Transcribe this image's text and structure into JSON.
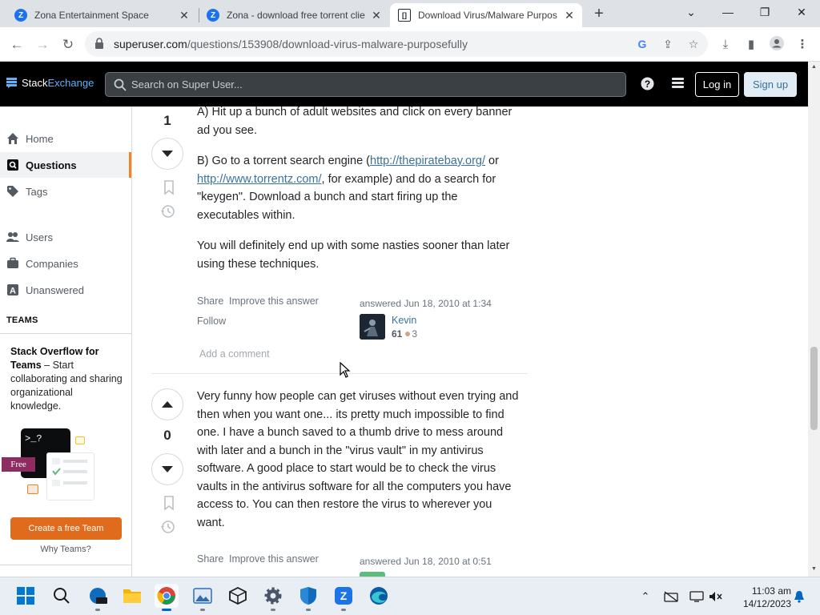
{
  "browser": {
    "tabs": [
      {
        "title": "Zona Entertainment Space",
        "favicon": "Z"
      },
      {
        "title": "Zona - download free torrent clie",
        "favicon": "Z"
      },
      {
        "title": "Download Virus/Malware Purpos",
        "favicon": "[]"
      }
    ],
    "url_host": "superuser.com",
    "url_path": "/questions/153908/download-virus-malware-purposefully"
  },
  "site": {
    "logo_part1": "Stack",
    "logo_part2": "Exchange",
    "search_placeholder": "Search on Super User...",
    "login_label": "Log in",
    "signup_label": "Sign up"
  },
  "sidebar": {
    "items": [
      {
        "label": "Home",
        "icon": "home-icon"
      },
      {
        "label": "Questions",
        "icon": "questions-icon"
      },
      {
        "label": "Tags",
        "icon": "tag-icon"
      },
      {
        "label": "Users",
        "icon": "users-icon"
      },
      {
        "label": "Companies",
        "icon": "companies-icon"
      },
      {
        "label": "Unanswered",
        "icon": "unanswered-icon"
      }
    ],
    "teams_heading": "TEAMS",
    "teams_title": "Stack Overflow for Teams",
    "teams_desc": " – Start collaborating and sharing organizational knowledge.",
    "free_badge": "Free",
    "terminal_text": ">_?",
    "create_team_label": "Create a free Team",
    "why_teams_label": "Why Teams?"
  },
  "answers": [
    {
      "score": "1",
      "p1": "A) Hit up a bunch of adult websites and click on every banner ad you see.",
      "p2_before": "B) Go to a torrent search engine (",
      "link1": "http://thepiratebay.org/",
      "p2_mid": " or ",
      "link2": "http://www.torrentz.com/",
      "p2_after": ", for example) and do a search for \"keygen\". Download a bunch and start firing up the executables within.",
      "p3": "You will definitely end up with some nasties sooner than later using these techniques.",
      "share": "Share",
      "improve": "Improve this answer",
      "follow": "Follow",
      "answered": "answered Jun 18, 2010 at 1:34",
      "user_name": "Kevin",
      "user_rep": "61",
      "user_bronze": "3",
      "add_comment": "Add a comment"
    },
    {
      "score": "0",
      "p1": "Very funny how people can get viruses without even trying and then when you want one... its pretty much impossible to find one. I have a bunch saved to a thumb drive to mess around with later and a bunch in the \"virus vault\" in my antivirus software. A good place to start would be to check the virus vaults in the antivirus software for all the computers you have access to. You can then restore the virus to wherever you want.",
      "share": "Share",
      "improve": "Improve this answer",
      "answered": "answered Jun 18, 2010 at 0:51"
    }
  ],
  "taskbar": {
    "time": "11:03 am",
    "date": "14/12/2023"
  },
  "colors": {
    "accent_orange": "#f48225",
    "link_blue": "#39739d",
    "topbar_black": "#000000"
  }
}
